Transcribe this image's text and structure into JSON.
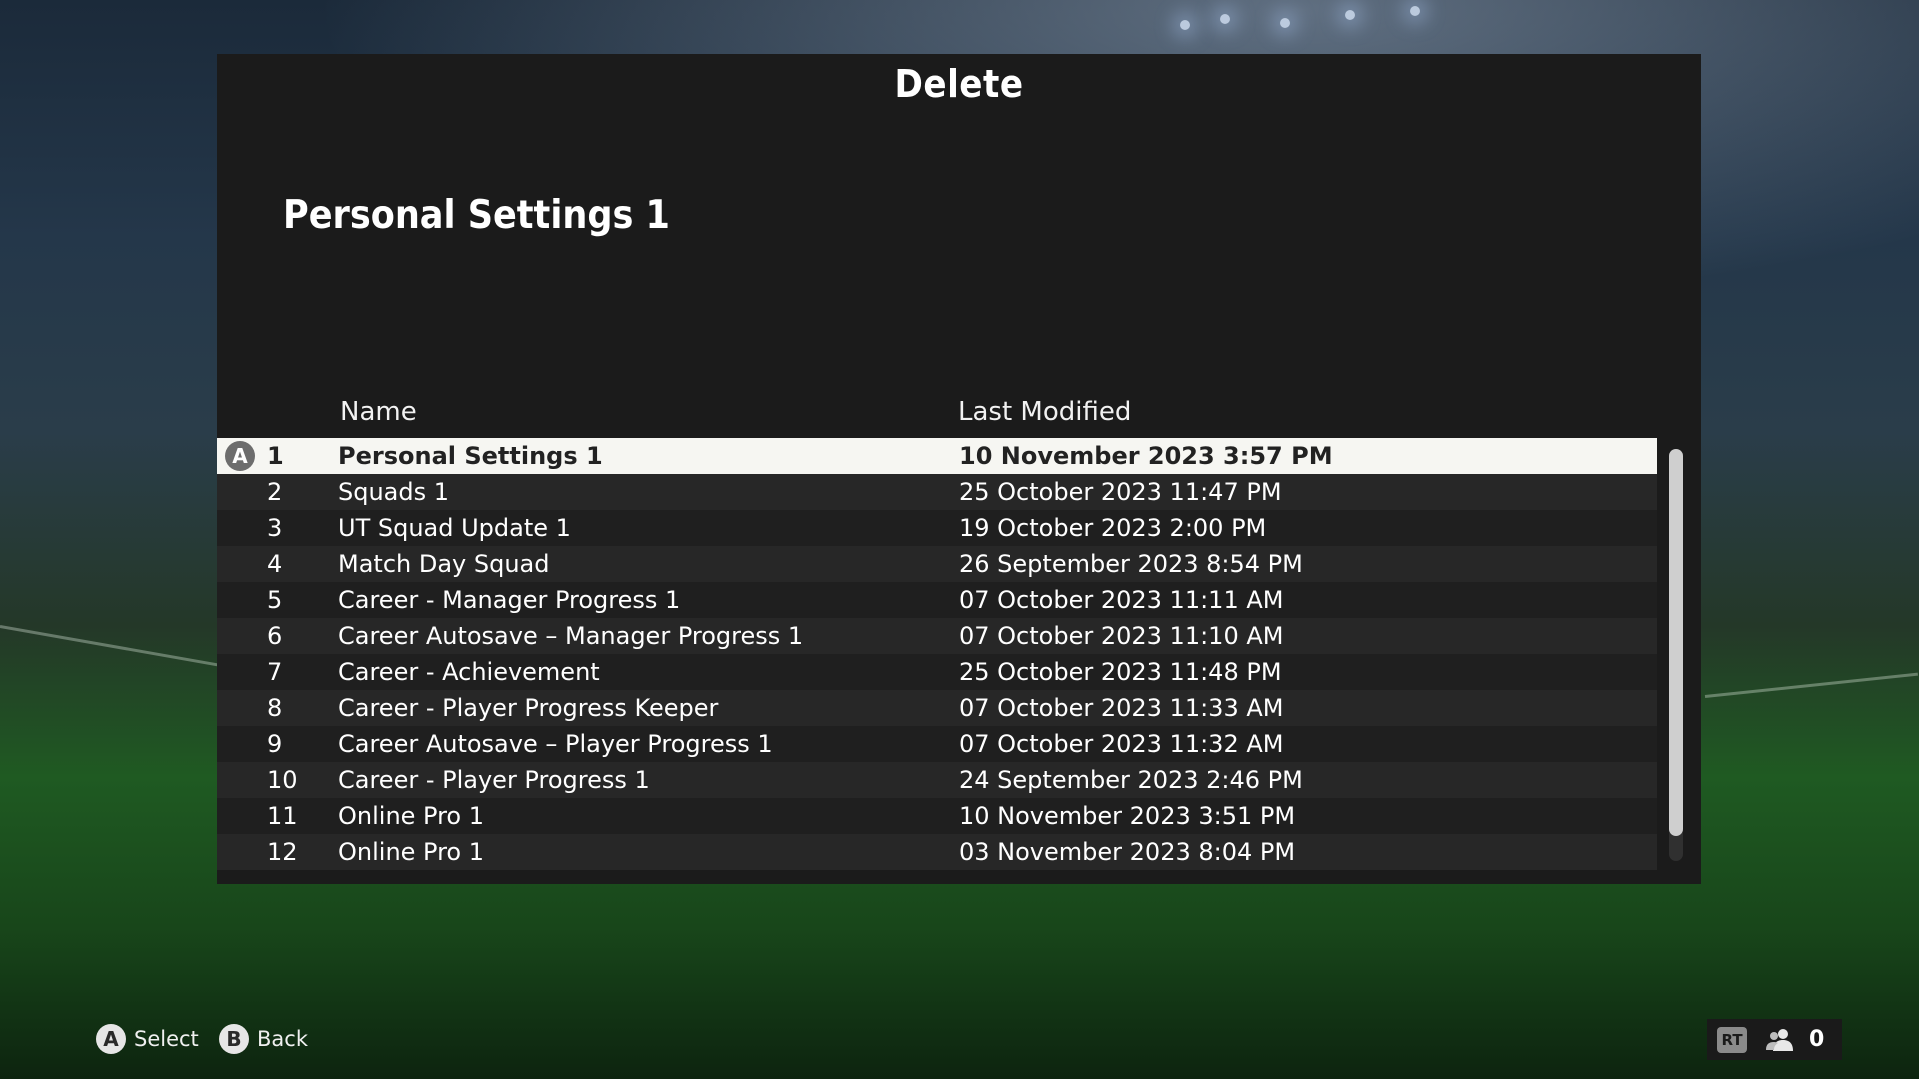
{
  "panel": {
    "title": "Delete",
    "subtitle": "Personal Settings 1"
  },
  "table": {
    "columns": {
      "name": "Name",
      "last_modified": "Last Modified"
    },
    "selected_index": 0,
    "selected_button_glyph": "A",
    "rows": [
      {
        "num": "1",
        "name": "Personal Settings 1",
        "date": "10 November 2023 3:57 PM"
      },
      {
        "num": "2",
        "name": "Squads 1",
        "date": "25 October 2023 11:47 PM"
      },
      {
        "num": "3",
        "name": "UT Squad Update 1",
        "date": "19 October 2023 2:00 PM"
      },
      {
        "num": "4",
        "name": "Match Day Squad",
        "date": "26 September 2023 8:54 PM"
      },
      {
        "num": "5",
        "name": "Career - Manager Progress 1",
        "date": "07 October 2023 11:11 AM"
      },
      {
        "num": "6",
        "name": "Career Autosave – Manager Progress 1",
        "date": "07 October 2023 11:10 AM"
      },
      {
        "num": "7",
        "name": "Career - Achievement",
        "date": "25 October 2023 11:48 PM"
      },
      {
        "num": "8",
        "name": "Career - Player Progress Keeper",
        "date": "07 October 2023 11:33 AM"
      },
      {
        "num": "9",
        "name": "Career Autosave – Player Progress 1",
        "date": "07 October 2023 11:32 AM"
      },
      {
        "num": "10",
        "name": "Career - Player Progress 1",
        "date": "24 September 2023 2:46 PM"
      },
      {
        "num": "11",
        "name": "Online Pro 1",
        "date": "10 November 2023 3:51 PM"
      },
      {
        "num": "12",
        "name": "Online Pro 1",
        "date": "03 November 2023 8:04 PM"
      }
    ],
    "scrollbar_visible_fraction": 0.94
  },
  "footer": {
    "select": {
      "glyph": "A",
      "label": "Select"
    },
    "back": {
      "glyph": "B",
      "label": "Back"
    }
  },
  "party": {
    "rt_label": "RT",
    "count": "0",
    "icon": "people-icon"
  },
  "colors": {
    "panel_bg": "#1b1b1b",
    "selected_row_bg": "#f6f6f2",
    "row_alt_bg": "#272727"
  }
}
